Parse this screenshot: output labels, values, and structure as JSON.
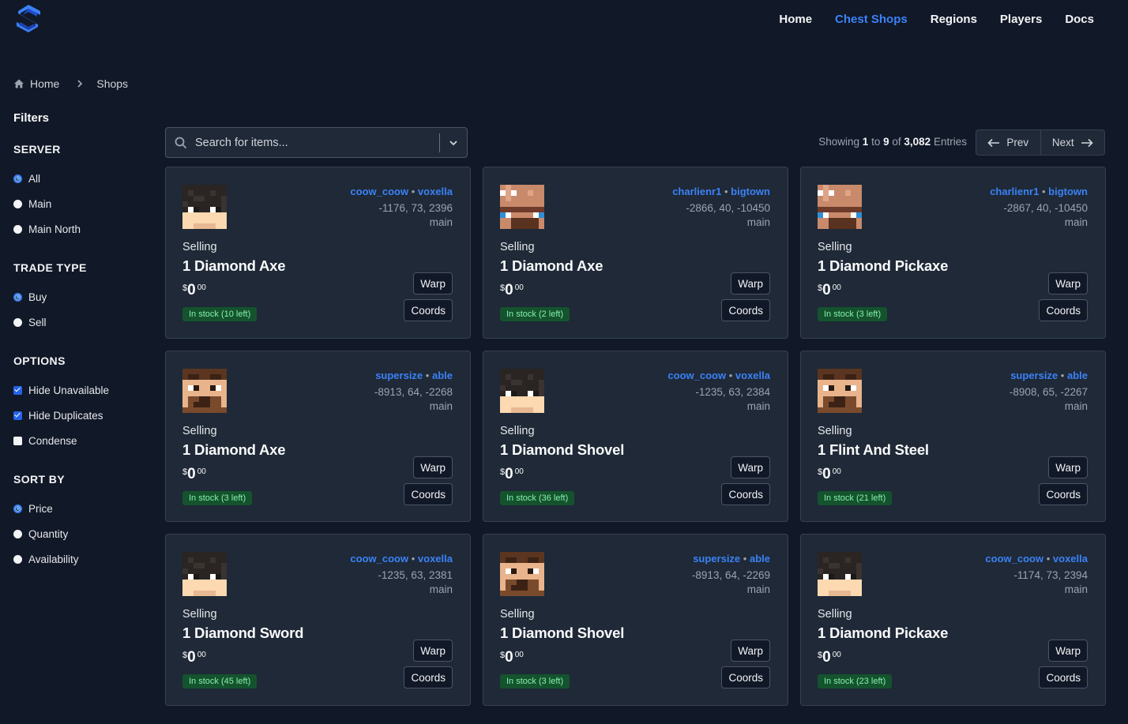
{
  "nav": {
    "items": [
      "Home",
      "Chest Shops",
      "Regions",
      "Players",
      "Docs"
    ],
    "active_index": 1
  },
  "breadcrumb": {
    "home": "Home",
    "current": "Shops"
  },
  "sidebar": {
    "title": "Filters",
    "server": {
      "title": "SERVER",
      "options": [
        "All",
        "Main",
        "Main North"
      ],
      "selected": 0
    },
    "trade_type": {
      "title": "TRADE TYPE",
      "options": [
        "Buy",
        "Sell"
      ],
      "selected": 0
    },
    "options": {
      "title": "OPTIONS",
      "items": [
        {
          "label": "Hide Unavailable",
          "checked": true
        },
        {
          "label": "Hide Duplicates",
          "checked": true
        },
        {
          "label": "Condense",
          "checked": false
        }
      ]
    },
    "sort_by": {
      "title": "SORT BY",
      "options": [
        "Price",
        "Quantity",
        "Availability"
      ],
      "selected": 0
    }
  },
  "search": {
    "placeholder": "Search for items...",
    "value": ""
  },
  "pagination": {
    "showing_label": "Showing",
    "from": "1",
    "to_word": "to",
    "to": "9",
    "of_word": "of",
    "total": "3,082",
    "entries_word": "Entries",
    "prev": "Prev",
    "next": "Next"
  },
  "card_labels": {
    "warp": "Warp",
    "coords": "Coords"
  },
  "shops": [
    {
      "owner": "coow_coow",
      "town": "voxella",
      "coords": "-1176, 73, 2396",
      "world": "main",
      "mode": "Selling",
      "item": "1 Diamond Axe",
      "currency": "$",
      "price_main": "0",
      "price_cents": "00",
      "stock": "In stock (10 left)",
      "skin": "coow"
    },
    {
      "owner": "charlienr1",
      "town": "bigtown",
      "coords": "-2866, 40, -10450",
      "world": "main",
      "mode": "Selling",
      "item": "1 Diamond Axe",
      "currency": "$",
      "price_main": "0",
      "price_cents": "00",
      "stock": "In stock (2 left)",
      "skin": "charlie"
    },
    {
      "owner": "charlienr1",
      "town": "bigtown",
      "coords": "-2867, 40, -10450",
      "world": "main",
      "mode": "Selling",
      "item": "1 Diamond Pickaxe",
      "currency": "$",
      "price_main": "0",
      "price_cents": "00",
      "stock": "In stock (3 left)",
      "skin": "charlie"
    },
    {
      "owner": "supersize",
      "town": "able",
      "coords": "-8913, 64, -2268",
      "world": "main",
      "mode": "Selling",
      "item": "1 Diamond Axe",
      "currency": "$",
      "price_main": "0",
      "price_cents": "00",
      "stock": "In stock (3 left)",
      "skin": "super"
    },
    {
      "owner": "coow_coow",
      "town": "voxella",
      "coords": "-1235, 63, 2384",
      "world": "main",
      "mode": "Selling",
      "item": "1 Diamond Shovel",
      "currency": "$",
      "price_main": "0",
      "price_cents": "00",
      "stock": "In stock (36 left)",
      "skin": "coow"
    },
    {
      "owner": "supersize",
      "town": "able",
      "coords": "-8908, 65, -2267",
      "world": "main",
      "mode": "Selling",
      "item": "1 Flint And Steel",
      "currency": "$",
      "price_main": "0",
      "price_cents": "00",
      "stock": "In stock (21 left)",
      "skin": "super"
    },
    {
      "owner": "coow_coow",
      "town": "voxella",
      "coords": "-1235, 63, 2381",
      "world": "main",
      "mode": "Selling",
      "item": "1 Diamond Sword",
      "currency": "$",
      "price_main": "0",
      "price_cents": "00",
      "stock": "In stock (45 left)",
      "skin": "coow"
    },
    {
      "owner": "supersize",
      "town": "able",
      "coords": "-8913, 64, -2269",
      "world": "main",
      "mode": "Selling",
      "item": "1 Diamond Shovel",
      "currency": "$",
      "price_main": "0",
      "price_cents": "00",
      "stock": "In stock (3 left)",
      "skin": "super"
    },
    {
      "owner": "coow_coow",
      "town": "voxella",
      "coords": "-1174, 73, 2394",
      "world": "main",
      "mode": "Selling",
      "item": "1 Diamond Pickaxe",
      "currency": "$",
      "price_main": "0",
      "price_cents": "00",
      "stock": "In stock (23 left)",
      "skin": "coow"
    }
  ],
  "colors": {
    "accent": "#3b82f6",
    "background": "#111827",
    "card": "#1f2937",
    "stock_bg": "#14532d",
    "stock_text": "#86efac"
  }
}
